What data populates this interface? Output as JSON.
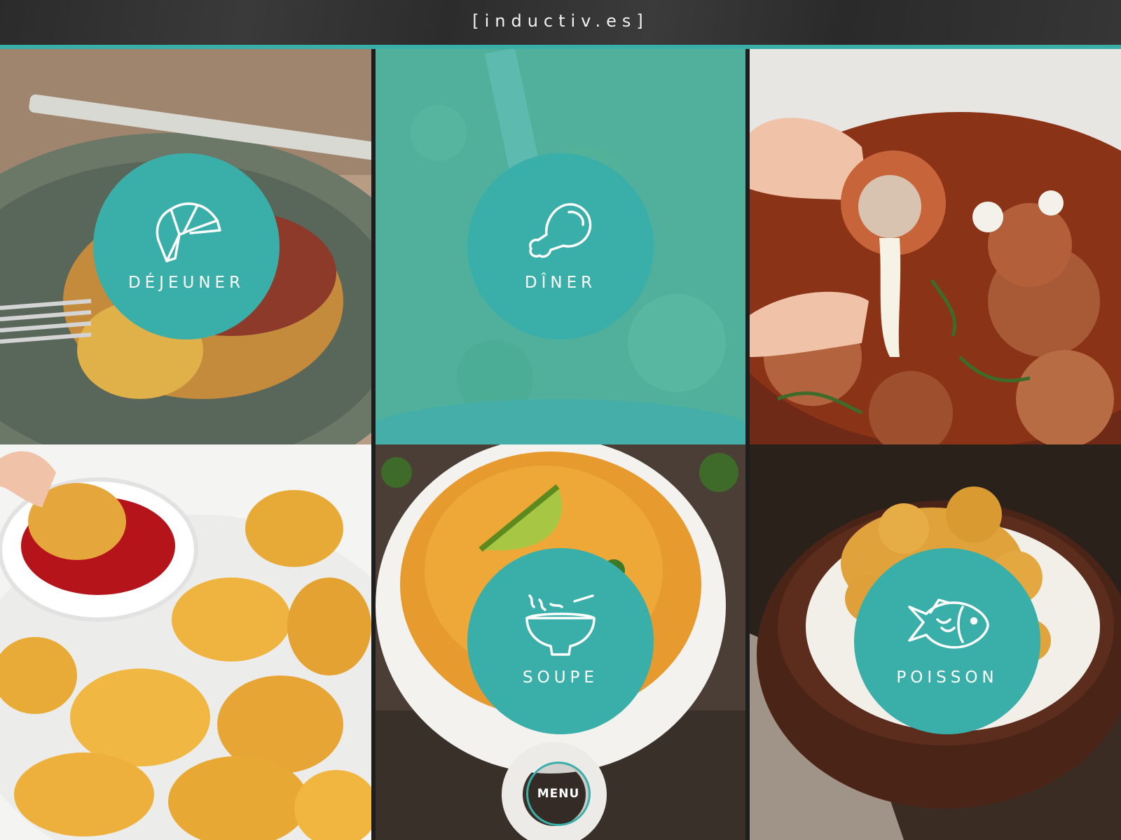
{
  "header": {
    "brand": "[inductiv.es]"
  },
  "colors": {
    "accent": "#3aafa9",
    "header_bg": "#2f2f2f"
  },
  "categories": [
    {
      "label": "DÉJEUNER",
      "icon": "croissant-icon"
    },
    {
      "label": "DÎNER",
      "icon": "chicken-leg-icon"
    },
    {
      "label": "SOUPE",
      "icon": "soup-bowl-icon"
    },
    {
      "label": "POISSON",
      "icon": "fish-icon"
    }
  ],
  "menu": {
    "label": "MENU"
  }
}
